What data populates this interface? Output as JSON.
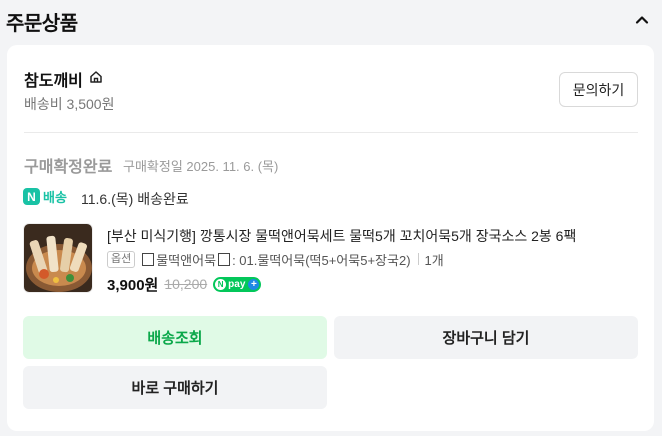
{
  "section": {
    "title": "주문상품"
  },
  "store": {
    "name": "참도깨비",
    "shipping_fee": "배송비 3,500원",
    "inquiry_label": "문의하기"
  },
  "order": {
    "status": "구매확정완료",
    "confirm_date": "구매확정일 2025. 11. 6. (목)",
    "delivery_badge_n": "N",
    "delivery_badge_label": "배송",
    "delivery_status": "11.6.(목) 배송완료"
  },
  "product": {
    "title": "[부산 미식기행] 깡통시장 물떡앤어묵세트 물떡5개 꼬치어묵5개 장국소스 2봉 6팩",
    "option_tag": "옵션",
    "option_name": "물떡앤어묵",
    "option_value": ": 01.물떡어묵(떡5+어묵5+장국2)",
    "quantity": "1개",
    "price": "3,900원",
    "original_price": "10,200",
    "npay_label": "pay"
  },
  "buttons": {
    "track": "배송조회",
    "cart": "장바구니 담기",
    "buy": "바로 구매하기"
  },
  "colors": {
    "npay_green": "#03c75a",
    "delivery_teal": "#19c2a5",
    "track_button_bg": "#e0fae6",
    "track_button_text": "#0ba84a"
  },
  "icons": {
    "collapse": "chevron-up-icon",
    "store_home": "home-icon",
    "option_box": "box-glyph"
  }
}
